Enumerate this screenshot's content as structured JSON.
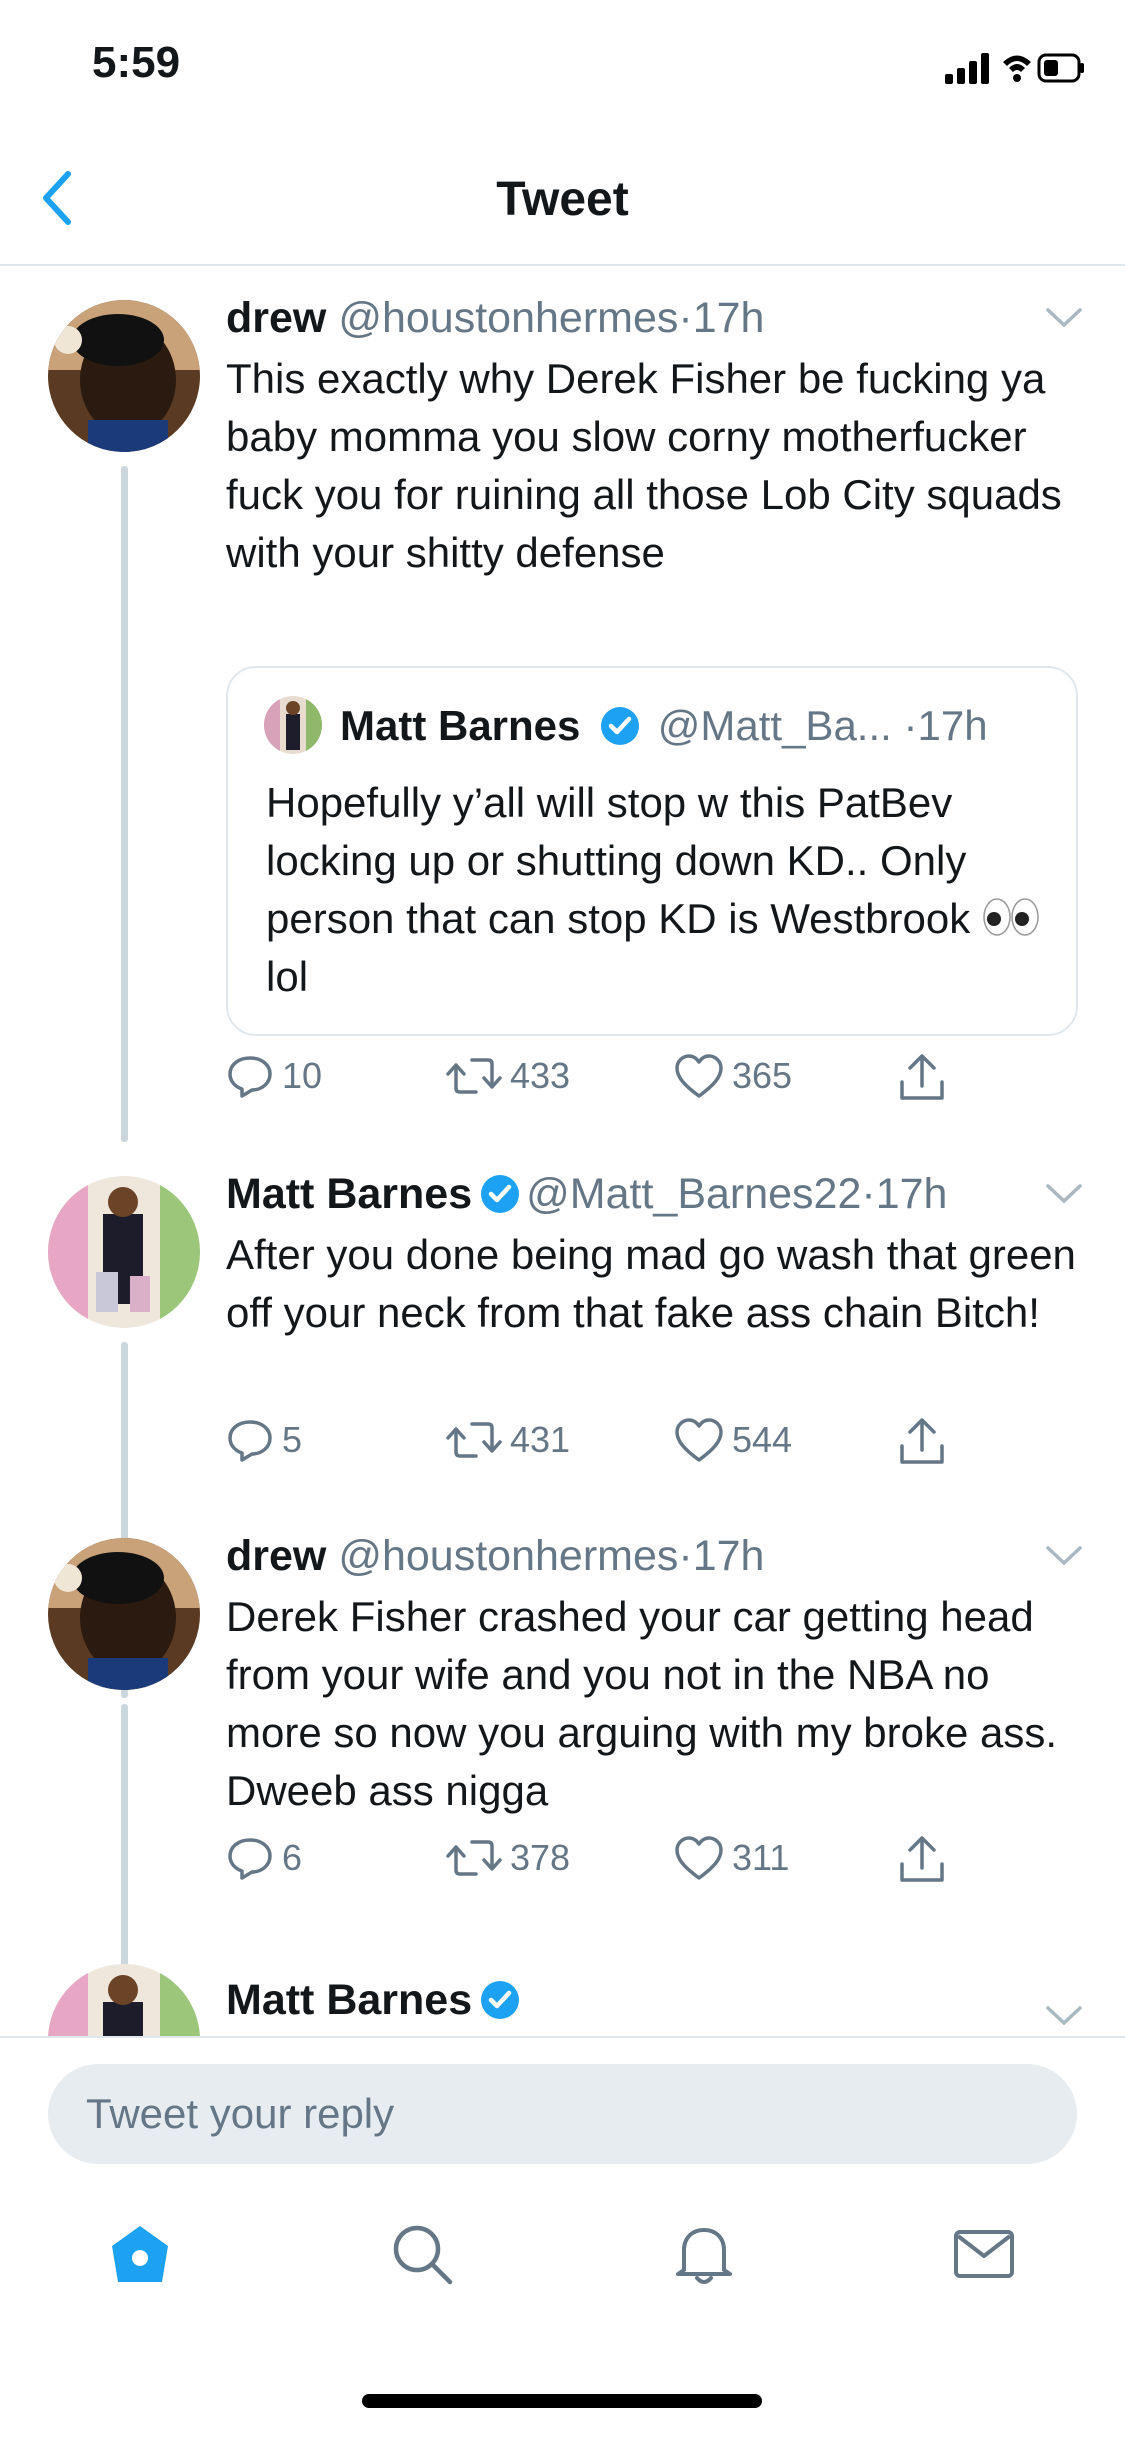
{
  "status_bar": {
    "time": "5:59"
  },
  "navbar": {
    "title": "Tweet"
  },
  "tweets": [
    {
      "name": "drew",
      "handle": "@houstonhermes",
      "sep": "·",
      "time": "17h",
      "text": "This exactly why Derek Fisher be fucking ya baby momma you slow corny motherfucker fuck you for ruining all those Lob City squads with your shitty defense",
      "quote": {
        "name": "Matt Barnes",
        "handle": "@Matt_Ba...",
        "sep": "·",
        "time": "17h",
        "text_before": "Hopefully y’all will stop w this PatBev locking up or shutting down KD.. Only person that can stop KD is Westbrook ",
        "text_after": "lol"
      },
      "replies": "10",
      "retweets": "433",
      "likes": "365"
    },
    {
      "name": "Matt Barnes",
      "handle": "@Matt_Barnes22",
      "sep": "·",
      "time": "17h",
      "text": "After you done being mad go wash that green off your neck from that fake ass chain Bitch!",
      "replies": "5",
      "retweets": "431",
      "likes": "544"
    },
    {
      "name": "drew",
      "handle": "@houstonhermes",
      "sep": "·",
      "time": "17h",
      "text": "Derek Fisher crashed your car getting head from your wife and you not in the NBA no more so now you arguing with my broke ass. Dweeb ass nigga",
      "replies": "6",
      "retweets": "378",
      "likes": "311"
    },
    {
      "name": "Matt Barnes"
    }
  ],
  "reply": {
    "placeholder": "Tweet your reply"
  },
  "tabs": [
    "home-icon",
    "search-icon",
    "bell-icon",
    "mail-icon"
  ],
  "colors": {
    "accent": "#1da1f2",
    "muted": "#657786",
    "line": "#ccd6dd"
  }
}
